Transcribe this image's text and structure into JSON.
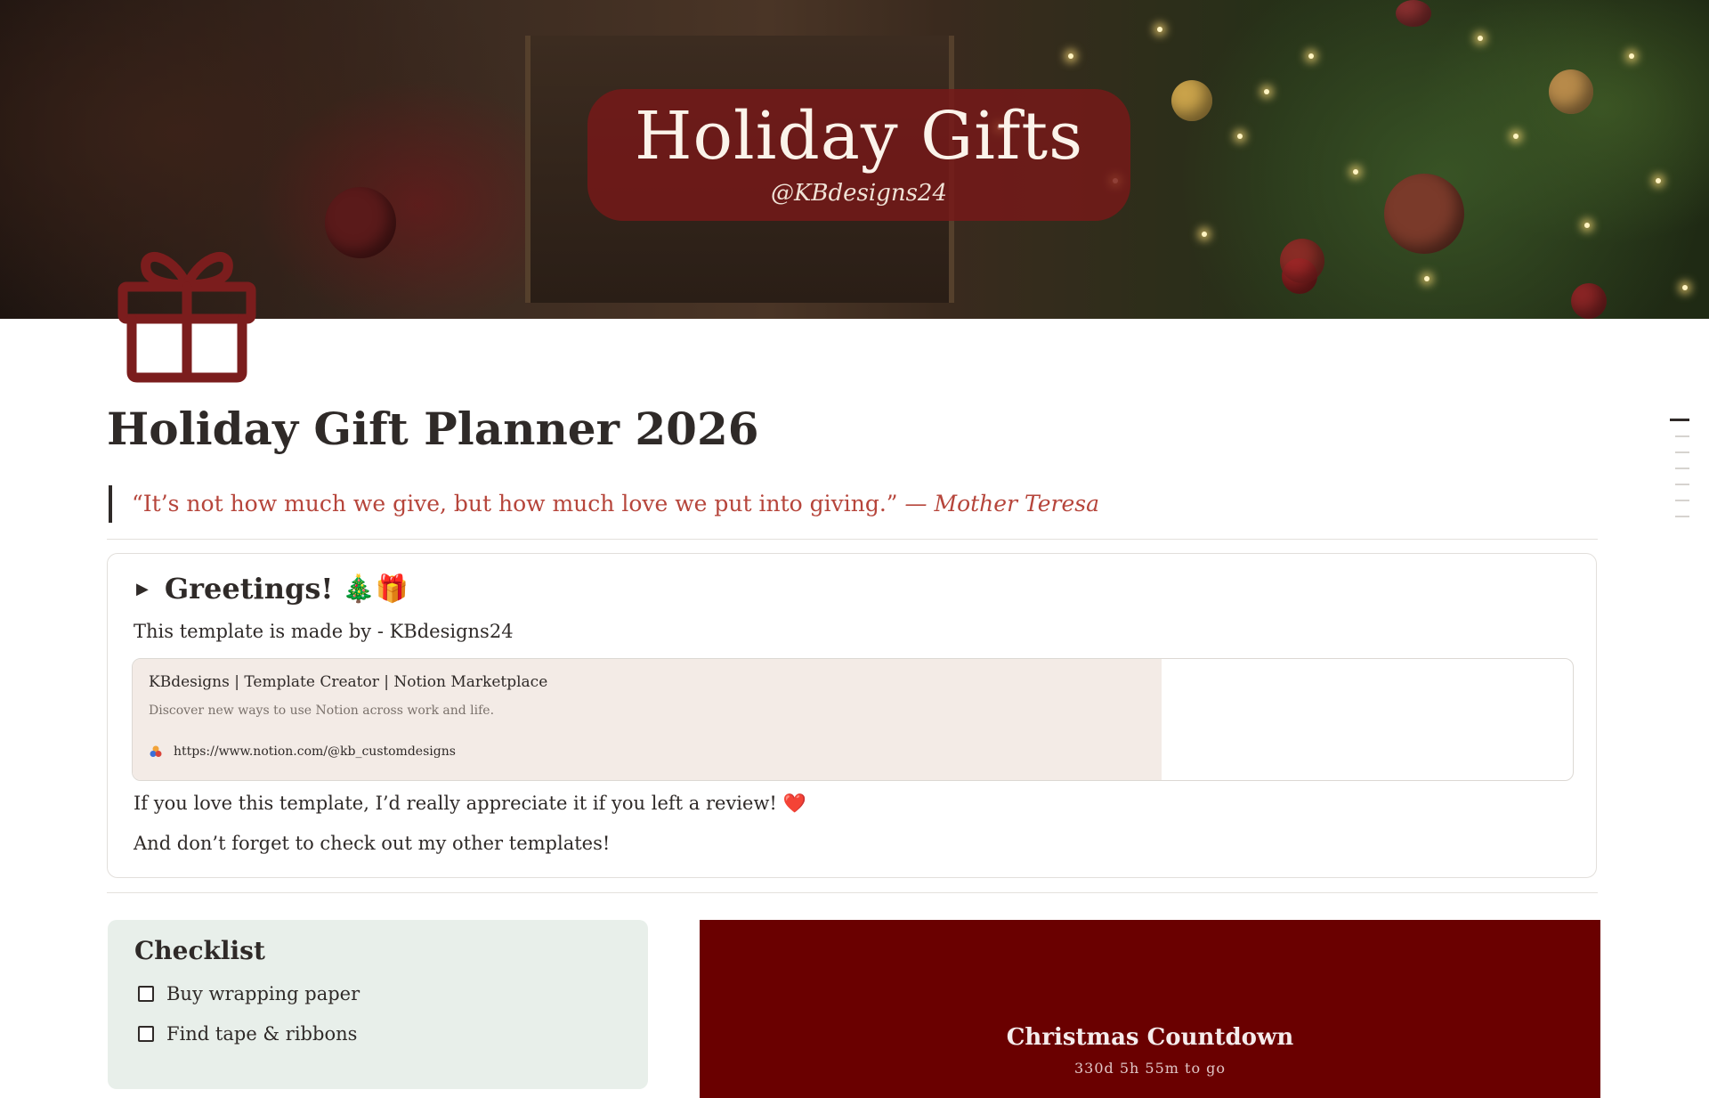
{
  "banner": {
    "title": "Holiday Gifts",
    "subtitle": "@KBdesigns24"
  },
  "page": {
    "icon": "gift-icon",
    "title": "Holiday Gift Planner 2026"
  },
  "quote": {
    "text": "“It’s not how much we give, but how much love we put into giving.” ",
    "author": "— Mother Teresa"
  },
  "greetings": {
    "heading": "Greetings!",
    "emoji": "🎄🎁",
    "made_by": "This template is made by - KBdesigns24",
    "bookmark": {
      "title": "KBdesigns | Template Creator | Notion Marketplace",
      "description": "Discover new ways to use Notion across work and life.",
      "url": "https://www.notion.com/@kb_customdesigns"
    },
    "review": "If you love this template, I’d really appreciate it if you left a review!",
    "review_emoji": "❤️",
    "other": "And don’t forget to check out my other templates!"
  },
  "checklist": {
    "title": "Checklist",
    "items": [
      {
        "label": "Buy wrapping paper",
        "checked": false
      },
      {
        "label": "Find tape & ribbons",
        "checked": false
      }
    ]
  },
  "countdown": {
    "title": "Christmas Countdown",
    "time": "330d 5h 55m to go"
  },
  "colors": {
    "accent_red": "#b6453b",
    "banner_plate": "#7a1919",
    "countdown_bg": "#6a0000",
    "checklist_bg": "#e8efea",
    "bookmark_bg": "#f3ebe6",
    "gift_icon": "#7b1d1d"
  }
}
